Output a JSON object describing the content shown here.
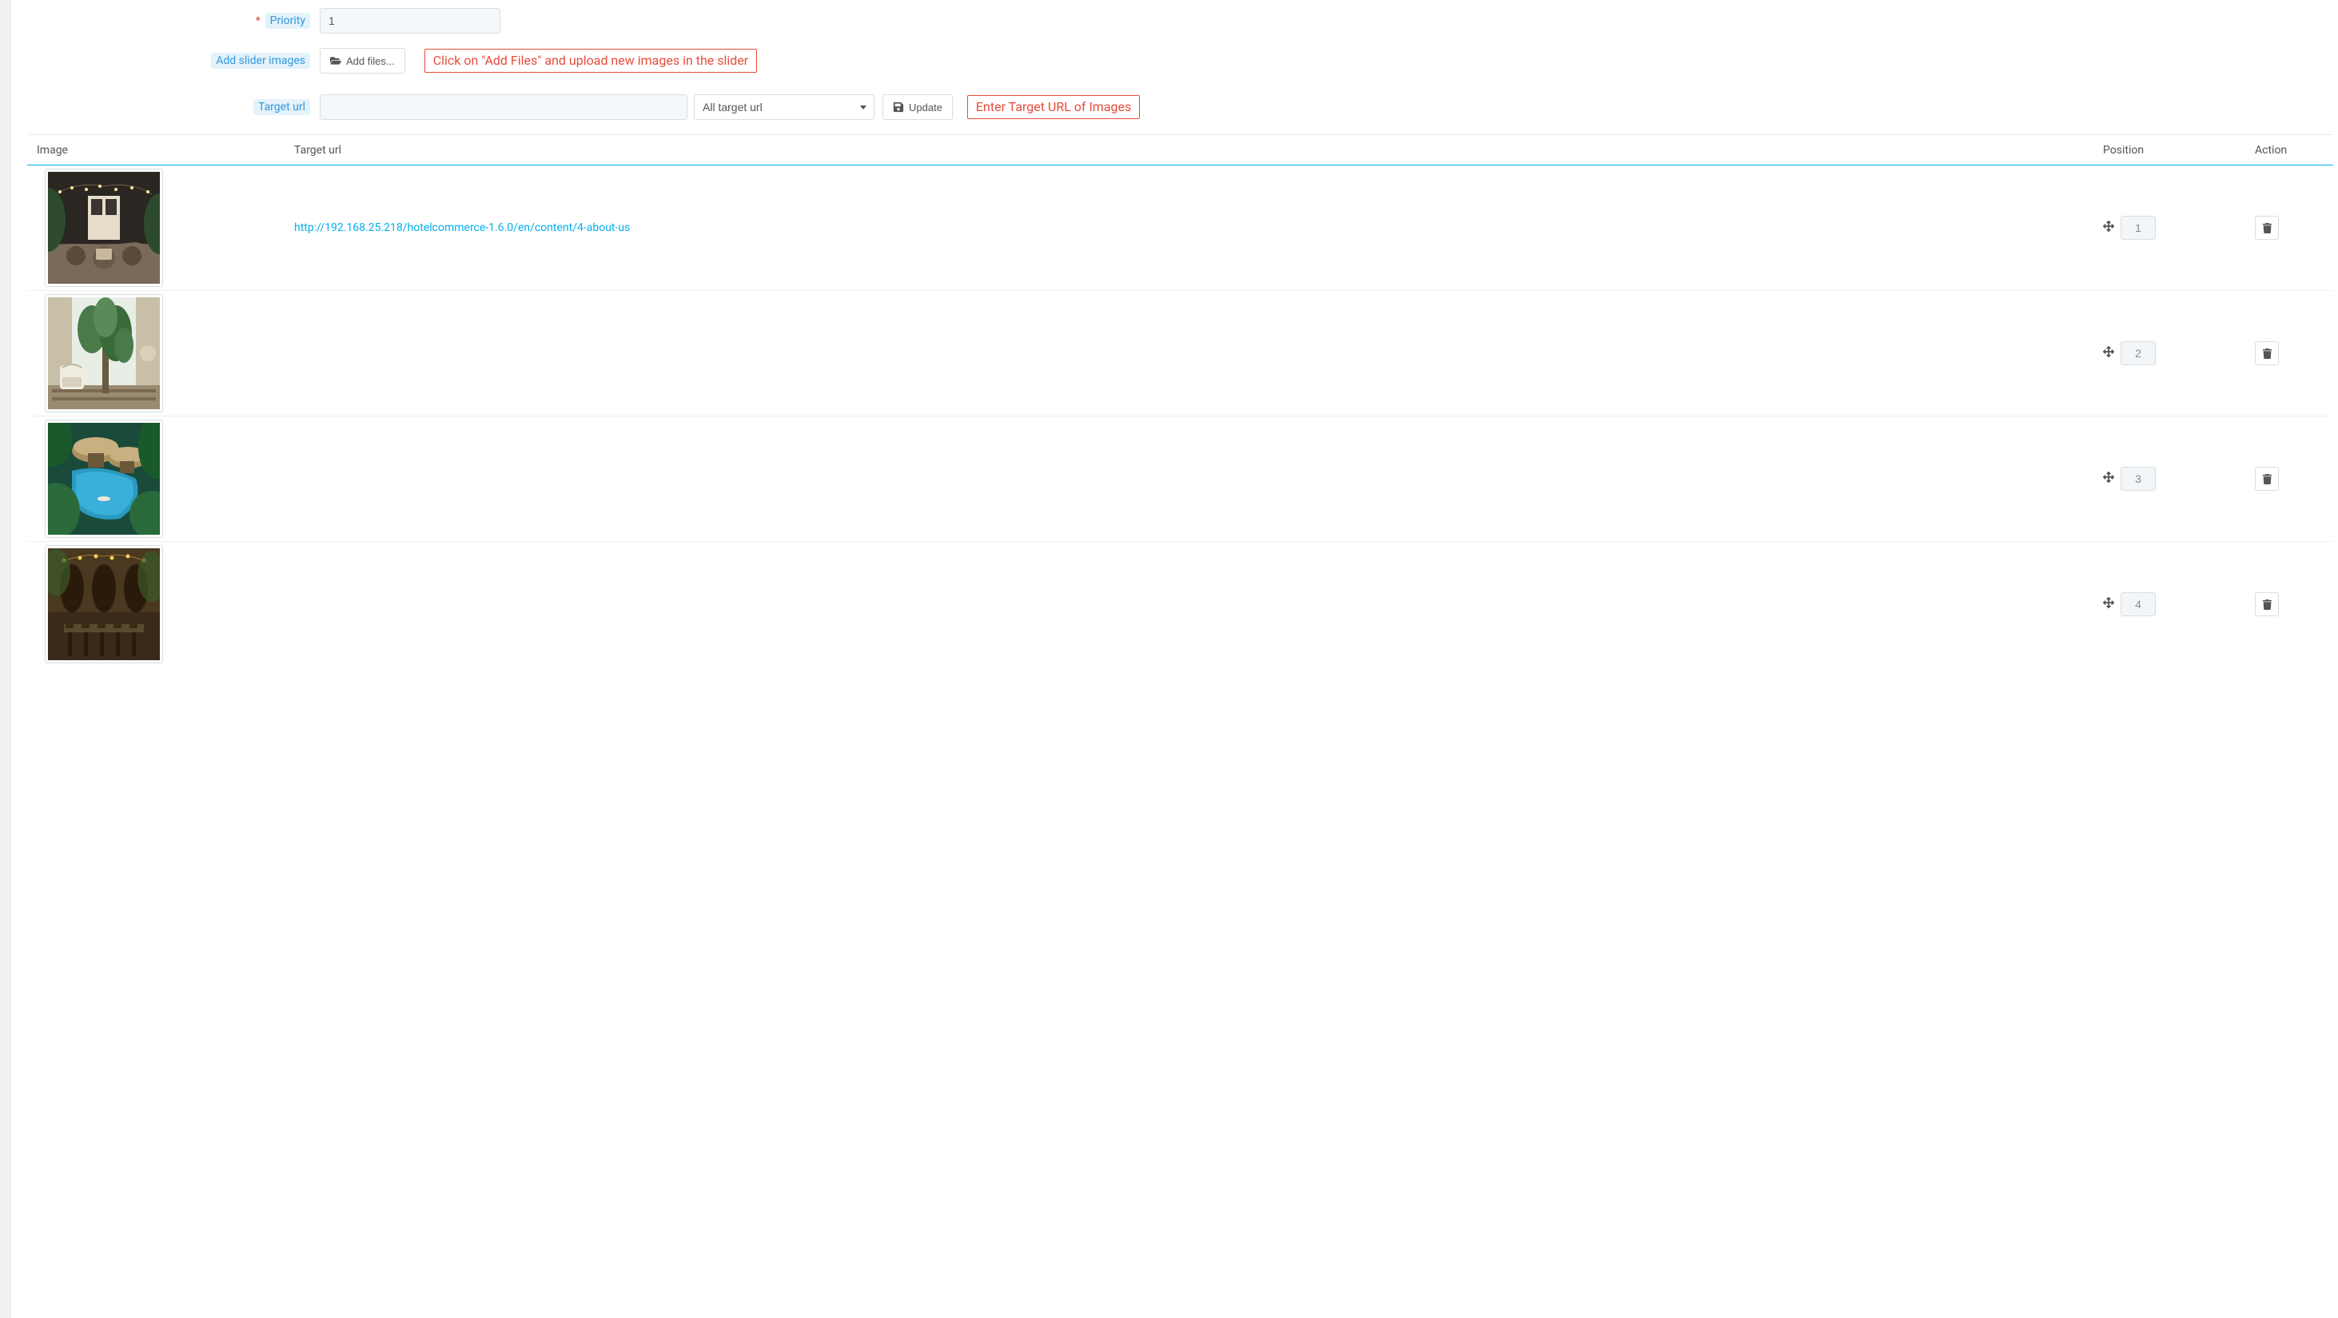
{
  "form": {
    "priority_label": "Priority",
    "priority_value": "1",
    "add_slider_images_label": "Add slider images",
    "add_files_label": "Add files...",
    "hint_add_files": "Click on \"Add Files\" and upload new images in the slider",
    "target_url_label": "Target url",
    "target_url_value": "",
    "target_url_select": "All target url",
    "update_label": "Update",
    "hint_target_url": "Enter Target URL of Images"
  },
  "table": {
    "headers": {
      "image": "Image",
      "target_url": "Target url",
      "position": "Position",
      "action": "Action"
    },
    "rows": [
      {
        "target_url": "http://192.168.25.218/hotelcommerce-1.6.0/en/content/4-about-us",
        "position": "1"
      },
      {
        "target_url": "",
        "position": "2"
      },
      {
        "target_url": "",
        "position": "3"
      },
      {
        "target_url": "",
        "position": "4"
      }
    ]
  }
}
